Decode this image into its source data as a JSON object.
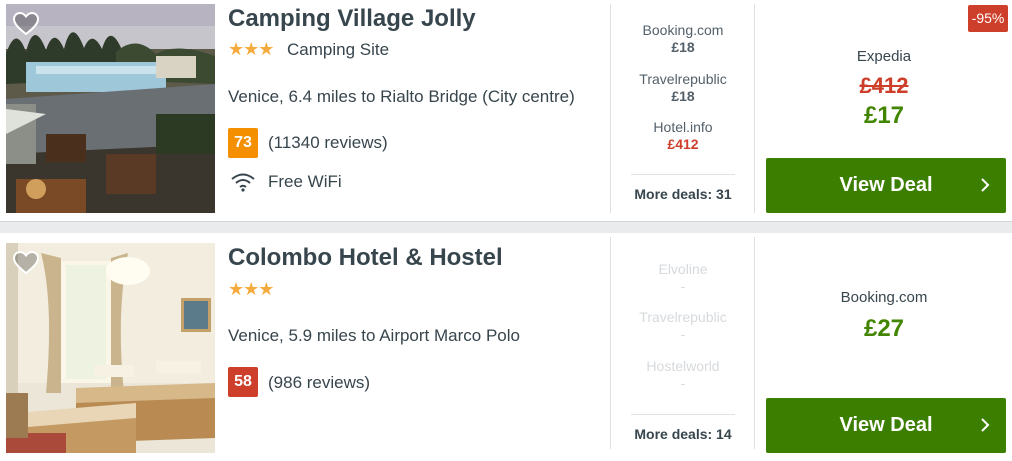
{
  "hotels": [
    {
      "name": "Camping Village Jolly",
      "stars": "★★★",
      "type": "Camping Site",
      "location": "Venice, 6.4 miles to Rialto Bridge (City centre)",
      "score": "73",
      "reviews": "(11340 reviews)",
      "amenity": "Free WiFi",
      "deals": [
        {
          "provider": "Booking.com",
          "price": "£18"
        },
        {
          "provider": "Travelrepublic",
          "price": "£18"
        },
        {
          "provider": "Hotel.info",
          "price": "£412"
        }
      ],
      "more_deals": "More deals: 31",
      "discount": "-95%",
      "best_provider": "Expedia",
      "old_price": "£412",
      "best_price": "£17",
      "cta": "View Deal"
    },
    {
      "name": "Colombo Hotel & Hostel",
      "stars": "★★★",
      "location": "Venice, 5.9 miles to Airport Marco Polo",
      "score": "58",
      "reviews": "(986 reviews)",
      "deals": [
        {
          "provider": "Elvoline",
          "price": "-"
        },
        {
          "provider": "Travelrepublic",
          "price": "-"
        },
        {
          "provider": "Hostelworld",
          "price": "-"
        }
      ],
      "more_deals": "More deals: 14",
      "best_provider": "Booking.com",
      "best_price": "£27",
      "cta": "View Deal"
    }
  ],
  "colors": {
    "accent_green": "#3c7f00",
    "price_green": "#428500",
    "alert_red": "#cd3f2a",
    "score_orange": "#f48f00",
    "star_yellow": "#f6ab3f"
  },
  "icons": [
    "heart-icon",
    "star-icon",
    "wifi-icon",
    "chevron-right-icon"
  ]
}
